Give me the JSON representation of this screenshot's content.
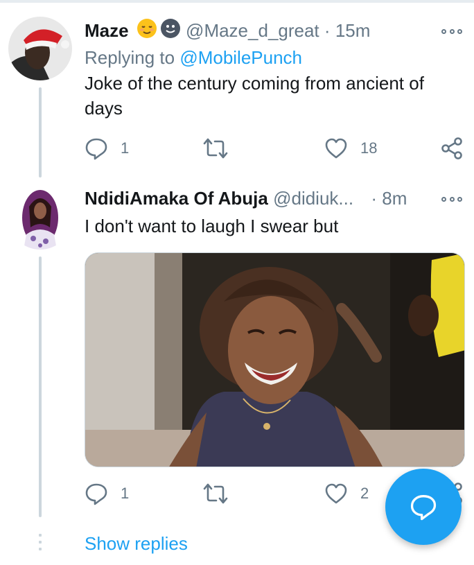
{
  "tweets": [
    {
      "author_name": "Maze",
      "author_emojis": [
        "relieved-face-emoji",
        "slightly-smiling-face-emoji"
      ],
      "handle": "@Maze_d_great",
      "separator": "·",
      "time": "15m",
      "replying_prefix": "Replying to",
      "replying_to": "@MobilePunch",
      "text": "Joke of the century coming from ancient of days",
      "reply_count": "1",
      "retweet_count": "",
      "like_count": "18"
    },
    {
      "author_name": "NdidiAmaka Of Abuja",
      "handle": "@didiuk...",
      "separator": "·",
      "time": "8m",
      "text": "I don't want to laugh I swear but",
      "reply_count": "1",
      "retweet_count": "",
      "like_count": "2",
      "media": "photo of a laughing woman in a dark top"
    }
  ],
  "show_replies": "Show replies",
  "icons": {
    "reply": "reply-icon",
    "retweet": "retweet-icon",
    "like": "heart-icon",
    "share": "share-icon",
    "more": "more-icon",
    "compose": "compose-reply-icon"
  },
  "colors": {
    "accent": "#1da1f2",
    "secondary_text": "#657786",
    "primary_text": "#14171a",
    "thread_line": "#ccd6dd"
  }
}
